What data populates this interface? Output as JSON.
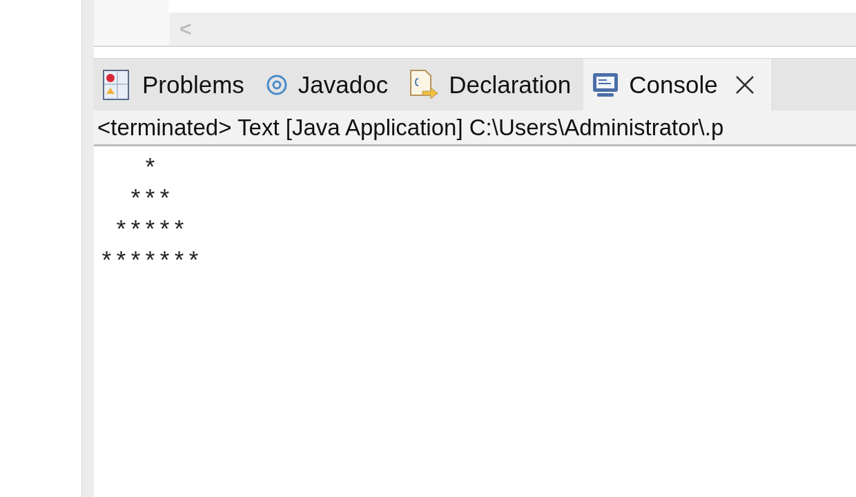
{
  "editor": {
    "scroll_arrow": "<"
  },
  "tabs": [
    {
      "label": "Problems",
      "selected": false
    },
    {
      "label": "Javadoc",
      "selected": false
    },
    {
      "label": "Declaration",
      "selected": false
    },
    {
      "label": "Console",
      "selected": true
    }
  ],
  "console": {
    "status": "<terminated> Text [Java Application] C:\\Users\\Administrator\\.p",
    "output": "   *\n  ***\n *****\n*******"
  }
}
